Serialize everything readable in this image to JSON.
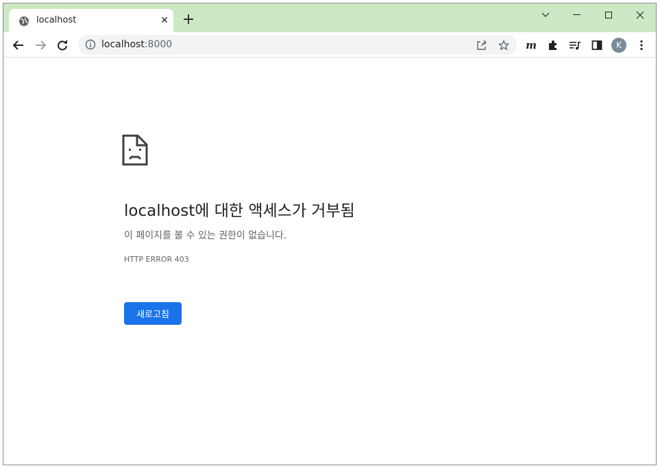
{
  "tab": {
    "title": "localhost"
  },
  "omnibox": {
    "host": "localhost",
    "port": ":8000"
  },
  "profile": {
    "initial": "K"
  },
  "error": {
    "title_host": "localhost",
    "title_rest": "에 대한 액세스가 거부됨",
    "subtitle": "이 페이지를 볼 수 있는 권한이 없습니다.",
    "code": "HTTP ERROR 403",
    "reload_label": "새로고침"
  },
  "colors": {
    "titlebar": "#cbe9c4",
    "accent": "#1a73e8",
    "avatar": "#7a8a9a"
  },
  "icons": [
    "globe-icon",
    "close-icon",
    "plus-icon",
    "chevron-down-icon",
    "minimize-icon",
    "maximize-icon",
    "window-close-icon",
    "back-icon",
    "forward-icon",
    "reload-icon",
    "info-icon",
    "share-icon",
    "star-icon",
    "m-extension-icon",
    "puzzle-icon",
    "media-icon",
    "sidepanel-icon",
    "kebab-menu-icon",
    "sad-page-icon"
  ]
}
